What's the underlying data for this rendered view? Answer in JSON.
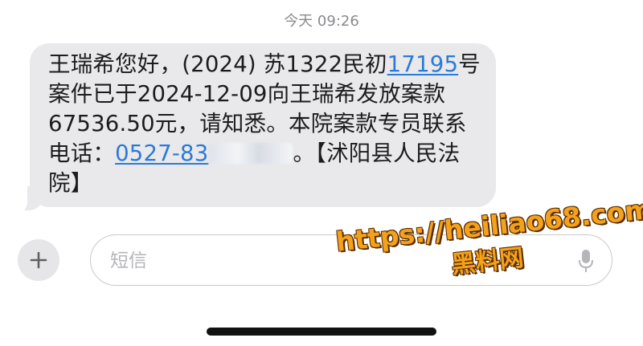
{
  "header": {
    "timestamp": "今天 09:26"
  },
  "message": {
    "part1": "王瑞希您好，(2024) 苏1322民初",
    "case_number_link": "17195",
    "part2": "号案件已于2024-12-09向王瑞希发放案款 67536.50元，请知悉。本院案款专员联系电话：",
    "phone_link": "0527-83",
    "part3": "。【沭阳县人民法院】"
  },
  "composer": {
    "placeholder": "短信"
  },
  "icons": {
    "add": "plus-icon",
    "mic": "microphone-icon"
  },
  "watermark": {
    "url": "https://heiliao68.com",
    "name": "黑料网"
  },
  "colors": {
    "bubble": "#e9e9eb",
    "link": "#2a7ad8",
    "watermark": "#f3a21a"
  }
}
